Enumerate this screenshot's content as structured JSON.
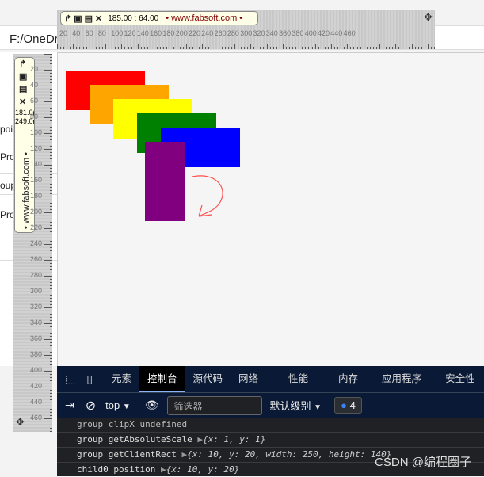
{
  "address": "F:/OneDri",
  "left_panel_fragments": [
    "poi",
    "Prop",
    "oup",
    "Prop"
  ],
  "hruler": {
    "coords": "185.00 : 64.00",
    "brand": "• www.fabsoft.com •",
    "labels": [
      "20",
      "40",
      "60",
      "80",
      "100",
      "120",
      "140",
      "160",
      "180",
      "200",
      "220",
      "240",
      "260",
      "280",
      "300",
      "320",
      "340",
      "360",
      "380",
      "400",
      "420",
      "440",
      "460"
    ]
  },
  "vruler": {
    "x": "181.0(",
    "y": "249.0(",
    "brand": "• www.fabsoft.com •",
    "labels": [
      "20",
      "40",
      "60",
      "80",
      "100",
      "120",
      "140",
      "160",
      "180",
      "200",
      "220",
      "240",
      "260",
      "280",
      "300",
      "320",
      "340",
      "360",
      "380",
      "400",
      "420",
      "440",
      "460"
    ]
  },
  "shapes": [
    {
      "color": "#ff0000"
    },
    {
      "color": "#ffa500"
    },
    {
      "color": "#ffff00"
    },
    {
      "color": "#008000"
    },
    {
      "color": "#0000ff"
    },
    {
      "color": "#800080"
    }
  ],
  "devtools": {
    "tabs": [
      "元素",
      "控制台",
      "源代码",
      "网络",
      "性能",
      "内存",
      "应用程序",
      "安全性"
    ],
    "active_tab": "控制台",
    "context": "top",
    "filter_placeholder": "筛选器",
    "level": "默认级别",
    "message_count": "4",
    "rows": [
      {
        "text": "group clipX undefined"
      },
      {
        "text": "group getAbsoluteScale",
        "obj": "{x: 1, y: 1}"
      },
      {
        "text": "group getClientRect",
        "obj": "{x: 10, y: 20, width: 250, height: 140}"
      },
      {
        "text": "child0 position",
        "obj": "{x: 10, y: 20}"
      }
    ]
  },
  "watermark": "CSDN @编程圈子"
}
